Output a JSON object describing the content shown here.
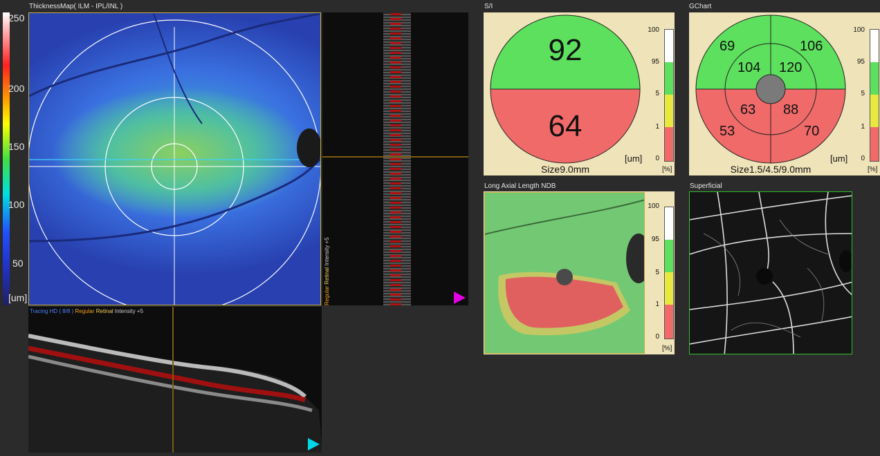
{
  "thickness_map": {
    "title": "ThicknessMap( ILM - IPL/INL )",
    "colorbar_ticks": [
      "250",
      "200",
      "150",
      "100",
      "50"
    ],
    "colorbar_unit": "[um]"
  },
  "bscan_vertical": {
    "overlay_regular": "Regular",
    "overlay_retinal": "Retinal",
    "overlay_intensity": "Intensity +5",
    "marker_color": "#e000e0"
  },
  "bscan_horizontal": {
    "overlay_tracing": "Tracing HD ( 8/8 )",
    "overlay_regular": "Regular",
    "overlay_retinal": "Retinal",
    "overlay_intensity": "Intensity +5",
    "marker_color": "#00d8e8"
  },
  "si_chart": {
    "title": "S/I",
    "superior": "92",
    "inferior": "64",
    "unit": "[um]",
    "size": "Size9.0mm",
    "scale_ticks": [
      "100",
      "95",
      "5",
      "1",
      "0"
    ],
    "scale_unit": "[%]"
  },
  "g_chart": {
    "title": "GChart",
    "outer_tl": "69",
    "outer_tr": "106",
    "inner_tl": "104",
    "inner_tr": "120",
    "inner_bl": "63",
    "inner_br": "88",
    "outer_bl": "53",
    "outer_br": "70",
    "unit": "[um]",
    "size": "Size1.5/4.5/9.0mm",
    "scale_ticks": [
      "100",
      "95",
      "5",
      "1",
      "0"
    ],
    "scale_unit": "[%]"
  },
  "ndb": {
    "title": "Long Axial Length NDB",
    "scale_ticks": [
      "100",
      "95",
      "5",
      "1",
      "0"
    ],
    "scale_unit": "[%]"
  },
  "superficial": {
    "title": "Superficial"
  },
  "colors": {
    "green": "#5de05d",
    "red": "#f06a6a",
    "yellow": "#e8e840",
    "beige": "#efe3b9"
  }
}
